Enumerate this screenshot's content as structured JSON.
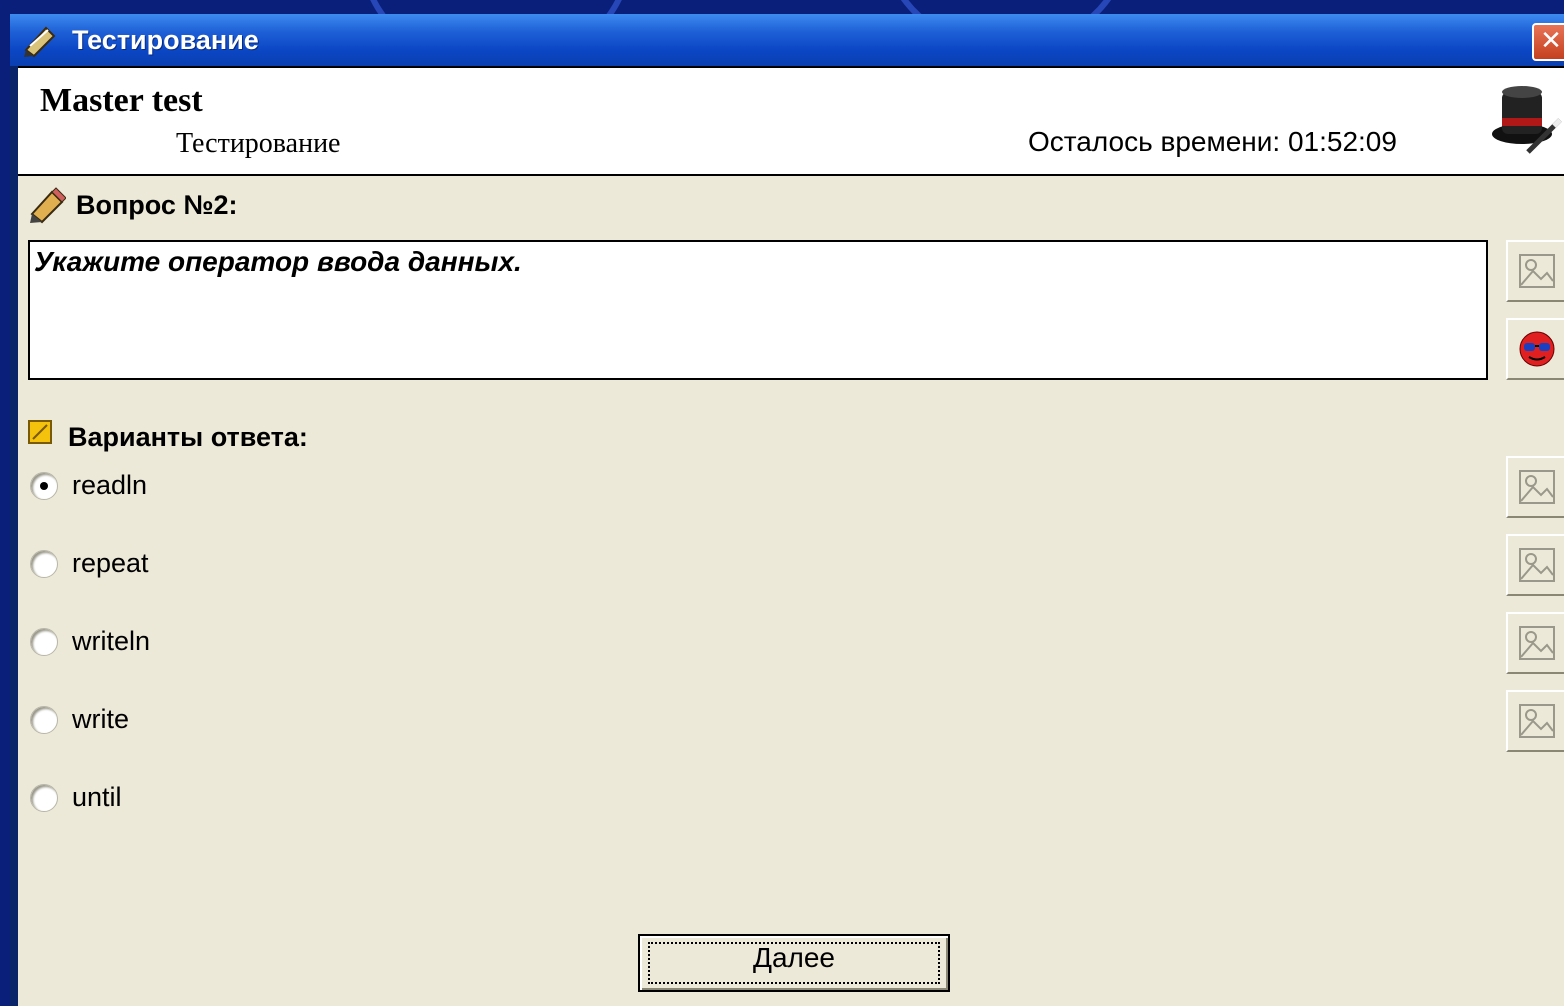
{
  "window": {
    "title": "Тестирование",
    "close_glyph": "✕"
  },
  "header": {
    "app_title": "Master test",
    "subtitle": "Тестирование",
    "time_left": "Осталось времени: 01:52:09"
  },
  "question": {
    "label": "Вопрос №2:",
    "text": "Укажите оператор ввода данных."
  },
  "options": {
    "label": "Варианты ответа:",
    "items": [
      {
        "text": "readln",
        "selected": true
      },
      {
        "text": "repeat",
        "selected": false
      },
      {
        "text": "writeln",
        "selected": false
      },
      {
        "text": "write",
        "selected": false
      },
      {
        "text": "until",
        "selected": false
      }
    ]
  },
  "buttons": {
    "next_label": "Далее"
  },
  "icons": {
    "window_icon": "pencil-icon",
    "hat": "magic-hat-icon",
    "question_image": "image-icon",
    "help": "smiley-glasses-icon",
    "option_image": "image-icon"
  },
  "colors": {
    "titlebar": "#0b46c4",
    "client_bg": "#ece9d8",
    "desktop": "#0a1f7a"
  }
}
